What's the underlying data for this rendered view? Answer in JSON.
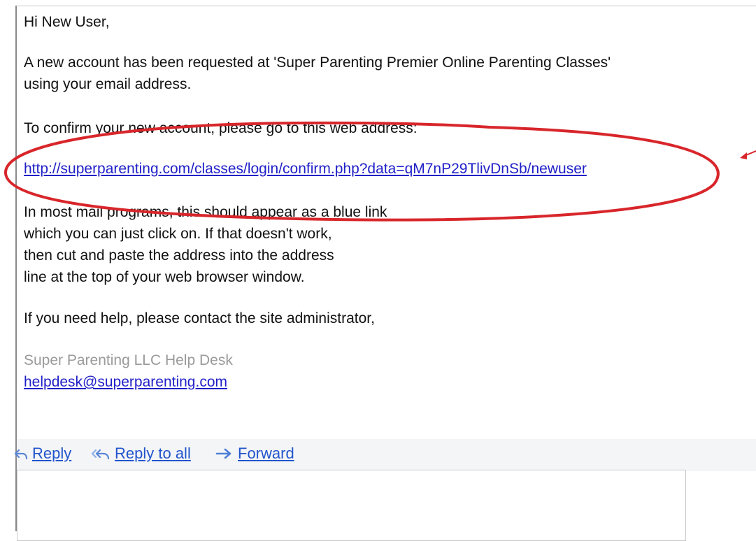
{
  "email": {
    "greeting": "Hi New User,",
    "request_line1": "A new account has been requested at 'Super Parenting Premier Online Parenting Classes'",
    "request_line2": "using your email address.",
    "confirm_instruction": "To confirm your new account, please go to this web address:",
    "confirm_link": "http://superparenting.com/classes/login/confirm.php?data=qM7nP29TlivDnSb/newuser",
    "mail_line1": "In most mail programs, this should appear as a blue link",
    "mail_line2": "which you can just click on. If that doesn't work,",
    "mail_line3": "then cut and paste the address into the address",
    "mail_line4": "line at the top of your web browser window.",
    "help_line": "If you need help, please contact the site administrator,",
    "signature_name": "Super Parenting LLC Help Desk",
    "signature_email": "helpdesk@superparenting.com"
  },
  "actions": {
    "reply": "Reply",
    "reply_all": "Reply to all",
    "forward": "Forward"
  },
  "icons": {
    "reply": "reply-icon",
    "reply_all": "reply-all-icon",
    "forward": "forward-icon",
    "annotation_arrow": "arrow-icon"
  },
  "colors": {
    "link": "#1f1fc8",
    "highlight": "#d8262b",
    "action_link": "#2255cc",
    "signature_gray": "#9a9a9a"
  }
}
